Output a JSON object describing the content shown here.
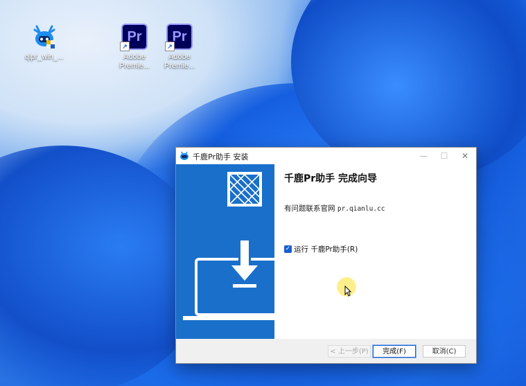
{
  "desktop": {
    "icons": [
      {
        "label": "qlpr_win_...",
        "icon": "deer-installer-icon"
      },
      {
        "label": "Adobe\nPremie...",
        "icon": "premiere-pro-icon",
        "glyph": "Pr"
      },
      {
        "label": "Adobe\nPremie...",
        "icon": "premiere-pro-icon",
        "glyph": "Pr"
      }
    ]
  },
  "window": {
    "title": "千鹿Pr助手 安装",
    "controls": {
      "minimize": "—",
      "maximize": "☐",
      "close": "✕"
    },
    "heading": "千鹿Pr助手 完成向导",
    "contact_prefix": "有问题联系官网",
    "contact_url": "pr.qianlu.cc",
    "run_checkbox": {
      "checked": true,
      "label": "运行 千鹿Pr助手(R)"
    },
    "buttons": {
      "back": "< 上一步(P)",
      "finish": "完成(F)",
      "cancel": "取消(C)"
    }
  },
  "colors": {
    "sidebar": "#1a6fca",
    "checkbox": "#1a5fd0",
    "premiere_bg": "#00005b",
    "premiere_fg": "#9999ff"
  }
}
